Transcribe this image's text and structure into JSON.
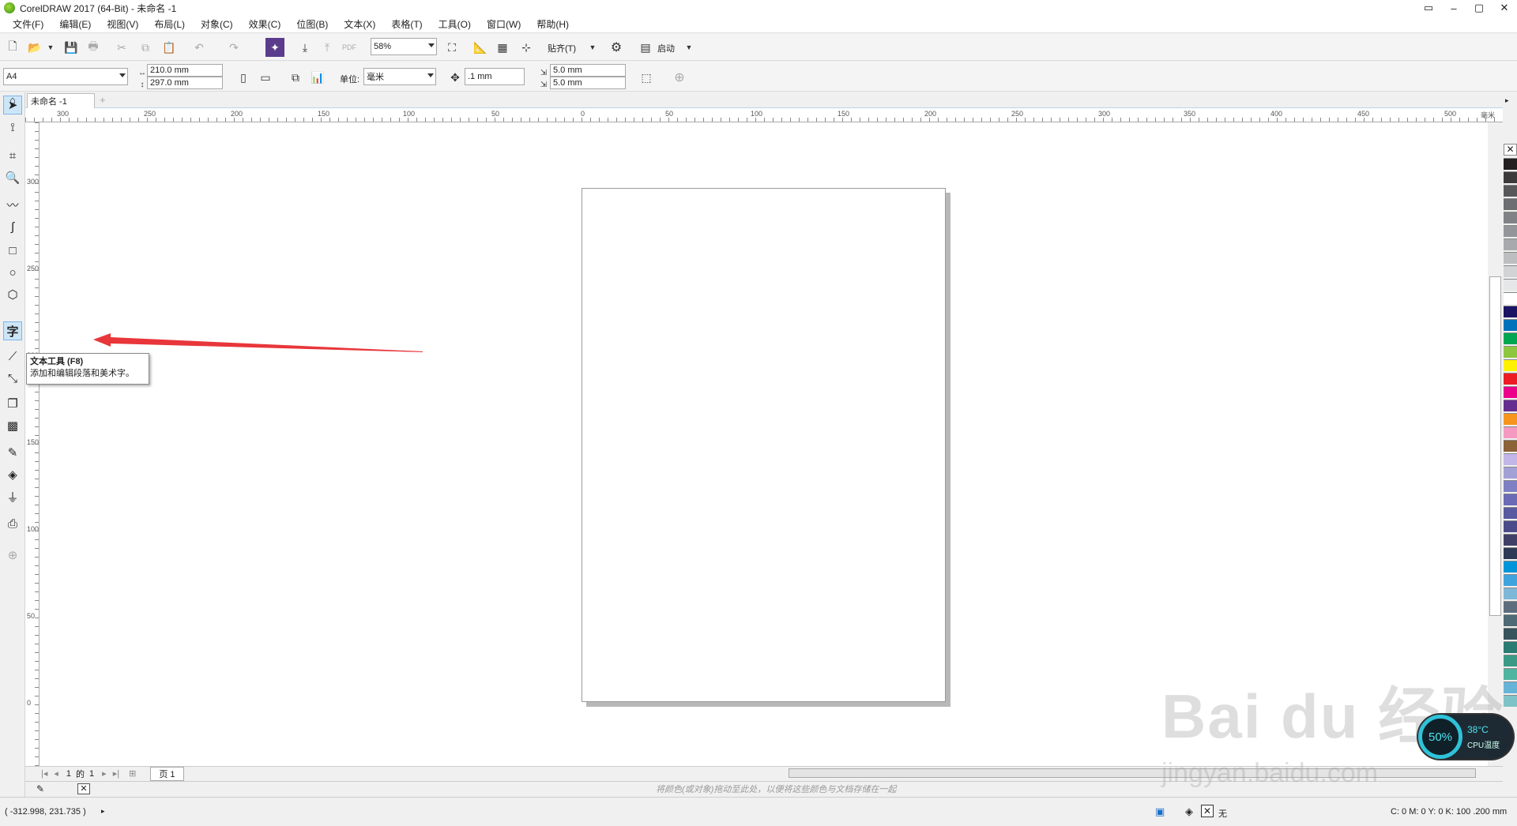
{
  "window": {
    "title": "CorelDRAW 2017 (64-Bit) - 未命名 -1",
    "controls": [
      "▭",
      "–",
      "▢",
      "✕"
    ]
  },
  "menu": [
    "文件(F)",
    "编辑(E)",
    "视图(V)",
    "布局(L)",
    "对象(C)",
    "效果(C)",
    "位图(B)",
    "文本(X)",
    "表格(T)",
    "工具(O)",
    "窗口(W)",
    "帮助(H)"
  ],
  "toolbar1": {
    "zoom": "58%",
    "snap_label": "贴齐(T)",
    "launch_label": "启动"
  },
  "toolbar2": {
    "page_size": "A4",
    "width": "210.0 mm",
    "height": "297.0 mm",
    "unit_label": "单位:",
    "unit": "毫米",
    "nudge": ".1 mm",
    "dup_x": "5.0 mm",
    "dup_y": "5.0 mm"
  },
  "doc_tab": "未命名 -1",
  "ruler": {
    "h_ticks": [
      "300",
      "250",
      "200",
      "150",
      "100",
      "50",
      "0",
      "50",
      "100",
      "150",
      "200",
      "250",
      "300",
      "350",
      "400",
      "450",
      "500"
    ],
    "h_unit": "毫米",
    "v_ticks": [
      "300",
      "250",
      "200",
      "150",
      "100",
      "50",
      "0"
    ]
  },
  "tooltip": {
    "title": "文本工具 (F8)",
    "desc": "添加和编辑段落和美术字。"
  },
  "page_nav": {
    "current": "1",
    "of": "的",
    "total": "1",
    "page_tab": "页 1"
  },
  "color_hint": "将颜色(或对象)拖动至此处，以便将这些颜色与文档存储在一起",
  "status": {
    "coords": "( -312.998, 231.735 )",
    "fill_none": "无",
    "outline_info": "C: 0 M: 0 Y: 0 K: 100  .200 mm"
  },
  "cpu": {
    "percent": "50%",
    "temp": "38°C",
    "label": "CPU温度"
  },
  "watermark": {
    "main": "Bai du 经验",
    "sub": "jingyan.baidu.com"
  },
  "palette": [
    "#231f20",
    "#3d3a3b",
    "#58585a",
    "#6d6e70",
    "#808285",
    "#939598",
    "#a7a9ac",
    "#bcbec0",
    "#d1d3d4",
    "#e6e7e8",
    "#ffffff",
    "#1b1464",
    "#0072bc",
    "#00a651",
    "#8dc63f",
    "#fff200",
    "#ed1c24",
    "#ec008c",
    "#662d91",
    "#f7941d",
    "#f49ac1",
    "#8c6239",
    "#c2b5e8",
    "#a3a0d6",
    "#7f7fc4",
    "#6a6ab5",
    "#5a5aa0",
    "#4b4b8a",
    "#404066",
    "#2e3a55",
    "#0095da",
    "#41a3dc",
    "#7fb7d9",
    "#5d6d7e",
    "#4d6a75",
    "#37535c",
    "#2a7b72",
    "#3a9a86",
    "#50b5a0",
    "#66b3d8",
    "#7ec3c6"
  ],
  "toolbox_icons": [
    "pick-tool-icon",
    "shape-tool-icon",
    "crop-tool-icon",
    "zoom-tool-icon",
    "freehand-tool-icon",
    "artistic-media-icon",
    "rectangle-tool-icon",
    "ellipse-tool-icon",
    "polygon-tool-icon",
    "text-tool-icon",
    "parallel-dimension-icon",
    "connector-tool-icon",
    "drop-shadow-icon",
    "transparency-icon",
    "eyedropper-icon",
    "interactive-fill-icon",
    "smart-fill-icon",
    "outline-pen-icon",
    "add-tool-icon"
  ]
}
